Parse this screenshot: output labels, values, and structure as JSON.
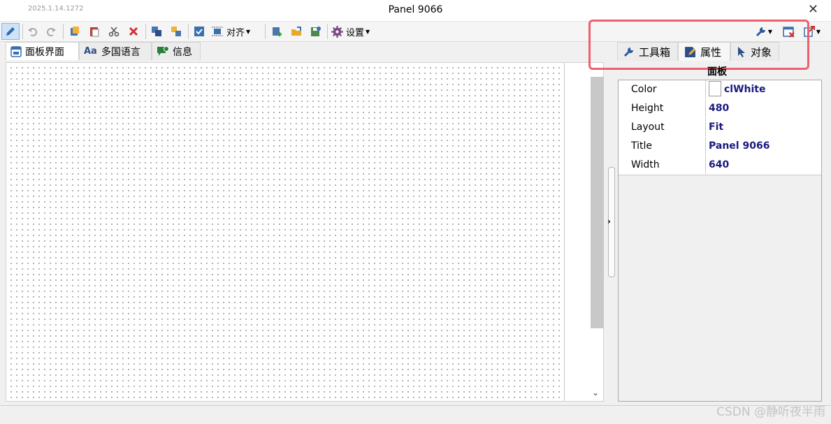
{
  "window": {
    "version": "2025.1.14.1272",
    "title": "Panel 9066",
    "close_glyph": "✕"
  },
  "toolbar": {
    "align_label": "对齐",
    "settings_label": "设置",
    "icons": [
      "pencil-icon",
      "undo-icon",
      "redo-icon",
      "copy-icon",
      "paste-icon",
      "cut-icon",
      "delete-icon",
      "bring-front-icon",
      "send-back-icon",
      "check-icon",
      "align-icon",
      "add-icon",
      "open-icon",
      "save-icon",
      "gear-icon",
      "wrench-icon",
      "close-window-icon",
      "export-icon"
    ]
  },
  "left_tabs": [
    {
      "label": "面板界面",
      "icon": "panel-icon"
    },
    {
      "label": "多国语言",
      "icon": "language-icon"
    },
    {
      "label": "信息",
      "icon": "message-icon"
    }
  ],
  "right_tabs": [
    {
      "label": "工具箱",
      "icon": "wrench-icon"
    },
    {
      "label": "属性",
      "icon": "edit-icon"
    },
    {
      "label": "对象",
      "icon": "cursor-icon"
    }
  ],
  "properties": {
    "header": "面板",
    "rows": [
      {
        "name": "Color",
        "value": "clWhite"
      },
      {
        "name": "Height",
        "value": "480"
      },
      {
        "name": "Layout",
        "value": "Fit"
      },
      {
        "name": "Title",
        "value": "Panel 9066"
      },
      {
        "name": "Width",
        "value": "640"
      }
    ]
  },
  "scroll": {
    "down_glyph": "⌄"
  },
  "collapse": {
    "glyph": "›"
  },
  "watermark": "CSDN @静听夜半雨",
  "colors": {
    "highlight": "#ef5f6e",
    "value_text": "#1a1a80",
    "accent": "#2b6cb0"
  }
}
